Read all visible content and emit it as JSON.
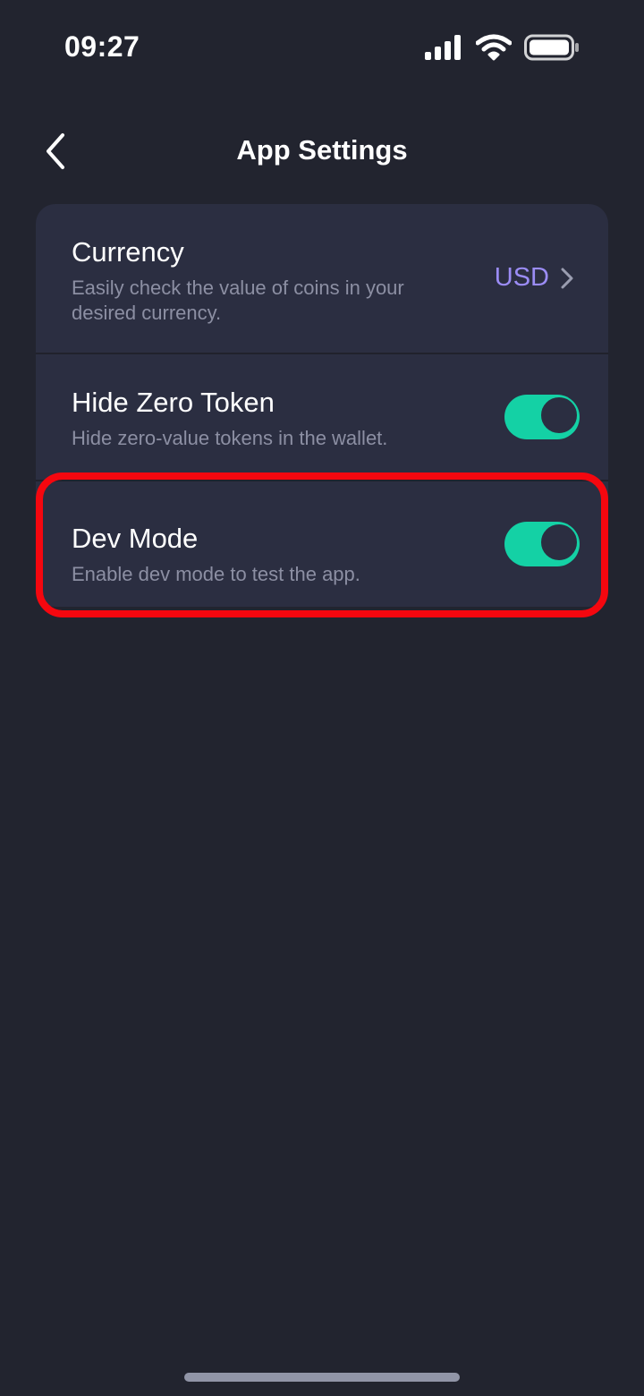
{
  "status_bar": {
    "time": "09:27",
    "icons": [
      "signal-icon",
      "wifi-icon",
      "battery-icon"
    ]
  },
  "header": {
    "title": "App Settings",
    "back_icon": "chevron-left-icon"
  },
  "settings": {
    "currency": {
      "title": "Currency",
      "description": "Easily check the value of coins in your desired currency.",
      "value": "USD"
    },
    "hide_zero_token": {
      "title": "Hide Zero Token",
      "description": "Hide zero-value tokens in the wallet.",
      "enabled": true
    },
    "dev_mode": {
      "title": "Dev Mode",
      "description": "Enable dev mode to test the app.",
      "enabled": true
    }
  },
  "colors": {
    "background": "#22242f",
    "card": "#2b2e41",
    "toggle_on": "#14d1a5",
    "currency_accent": "#9b8cf5",
    "highlight": "#f5070f"
  }
}
